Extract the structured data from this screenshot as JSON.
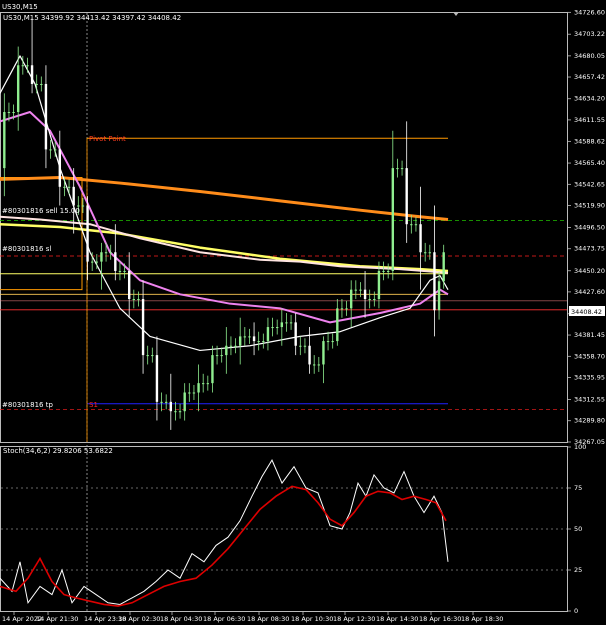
{
  "window": {
    "title": "US30,M15"
  },
  "main_panel": {
    "info_line": "US30,M15  34399.92 34413.42 34397.42 34408.42",
    "pivot_label": "Pivot Point",
    "orders": [
      {
        "label": "#80301816 sell 15.00",
        "color": "#20c000"
      },
      {
        "label": "#80301816 sl",
        "color": "#ff2020"
      },
      {
        "label": "#80301816 tp",
        "color": "#ff2020"
      }
    ],
    "s1_label": "S1",
    "current_price_tag": "34408.42"
  },
  "stoch_panel": {
    "title": "Stoch(34,6,2) 29.8206 53.6822",
    "levels": [
      "100",
      "75",
      "50",
      "25",
      "0"
    ]
  },
  "colors": {
    "background": "#000000",
    "grid": "#cfcfcf",
    "bull_candle": "#90ee90",
    "bear_candle": "#ffffff",
    "ema_white": "#ffffff",
    "ma_pink": "#ee82ee",
    "ma_pale": "#ffe4e1",
    "ma_yellow": "#ffff66",
    "ma_orange": "#ff8c1a",
    "pivot": "#ff9900",
    "tp_line": "#2020ff",
    "stoch_main": "#ffffff",
    "stoch_signal": "#dd0000"
  },
  "chart_data": {
    "type": "candlestick",
    "symbol": "US30",
    "timeframe": "M15",
    "ylim": [
      34267.05,
      34725.9
    ],
    "y_ticks": [
      "34726.60",
      "34703.22",
      "34680.05",
      "34657.42",
      "34634.20",
      "34611.55",
      "34588.62",
      "34565.40",
      "34542.65",
      "34519.90",
      "34496.50",
      "34473.75",
      "34450.20",
      "34427.60",
      "34404.20",
      "34381.45",
      "34358.70",
      "34335.95",
      "34312.55",
      "34289.80",
      "34267.05"
    ],
    "x_ticks": [
      "14 Apr 2022",
      "14 Apr 21:30",
      "14 Apr 23:30",
      "18 Apr 02:30",
      "18 Apr 04:30",
      "18 Apr 06:30",
      "18 Apr 08:30",
      "18 Apr 10:30",
      "18 Apr 12:30",
      "18 Apr 14:30",
      "18 Apr 16:30",
      "18 Apr 18:30"
    ],
    "levels": {
      "pivot_point": 34592,
      "sell_entry": 34504,
      "stop_loss": 34466,
      "take_profit": 34302,
      "s1": 34308,
      "bid": 34408.42
    },
    "candles_approx": [
      [
        34560,
        34640,
        34530,
        34620
      ],
      [
        34620,
        34690,
        34600,
        34670
      ],
      [
        34670,
        34720,
        34640,
        34650
      ],
      [
        34650,
        34670,
        34560,
        34580
      ],
      [
        34580,
        34600,
        34520,
        34540
      ],
      [
        34540,
        34560,
        34490,
        34520
      ],
      [
        34520,
        34530,
        34440,
        34460
      ],
      [
        34460,
        34480,
        34430,
        34470
      ],
      [
        34470,
        34500,
        34440,
        34450
      ],
      [
        34450,
        34470,
        34400,
        34420
      ],
      [
        34420,
        34440,
        34340,
        34360
      ],
      [
        34360,
        34380,
        34290,
        34310
      ],
      [
        34310,
        34340,
        34280,
        34300
      ],
      [
        34300,
        34330,
        34290,
        34320
      ],
      [
        34320,
        34350,
        34300,
        34330
      ],
      [
        34330,
        34370,
        34320,
        34360
      ],
      [
        34360,
        34390,
        34340,
        34370
      ],
      [
        34370,
        34400,
        34350,
        34380
      ],
      [
        34380,
        34395,
        34360,
        34375
      ],
      [
        34375,
        34400,
        34365,
        34390
      ],
      [
        34390,
        34410,
        34370,
        34395
      ],
      [
        34395,
        34405,
        34360,
        34370
      ],
      [
        34370,
        34390,
        34340,
        34350
      ],
      [
        34350,
        34380,
        34330,
        34375
      ],
      [
        34375,
        34420,
        34370,
        34410
      ],
      [
        34410,
        34440,
        34390,
        34430
      ],
      [
        34430,
        34450,
        34400,
        34420
      ],
      [
        34420,
        34460,
        34410,
        34450
      ],
      [
        34450,
        34600,
        34440,
        34560
      ],
      [
        34560,
        34610,
        34480,
        34500
      ],
      [
        34500,
        34540,
        34430,
        34470
      ],
      [
        34470,
        34520,
        34380,
        34408
      ]
    ]
  }
}
